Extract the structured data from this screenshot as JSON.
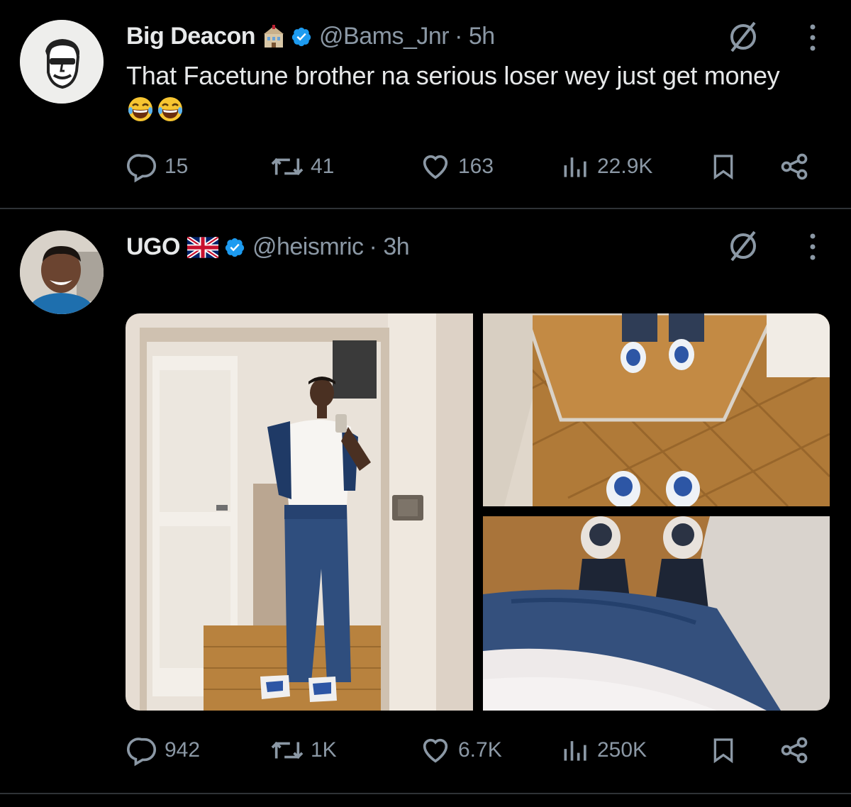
{
  "tweets": [
    {
      "author": "Big Deacon",
      "badge_icon": "building-emoji-icon",
      "handle": "@Bams_Jnr",
      "time": "· 5h",
      "text": "That Facetune brother na serious loser wey just get money",
      "emojis": [
        "😂",
        "😂"
      ],
      "stats": {
        "replies": "15",
        "reposts": "41",
        "likes": "163",
        "views": "22.9K"
      }
    },
    {
      "author": "UGO",
      "badge_icon": "uk-flag-icon",
      "handle": "@heismric",
      "time": "· 3h",
      "stats": {
        "replies": "942",
        "reposts": "1K",
        "likes": "6.7K",
        "views": "250K"
      },
      "media_count": 3
    }
  ],
  "colors": {
    "background": "#000000",
    "text": "#e7e9ea",
    "muted": "#8b98a5",
    "verified": "#1d9bf0",
    "divider": "#2f3336"
  }
}
